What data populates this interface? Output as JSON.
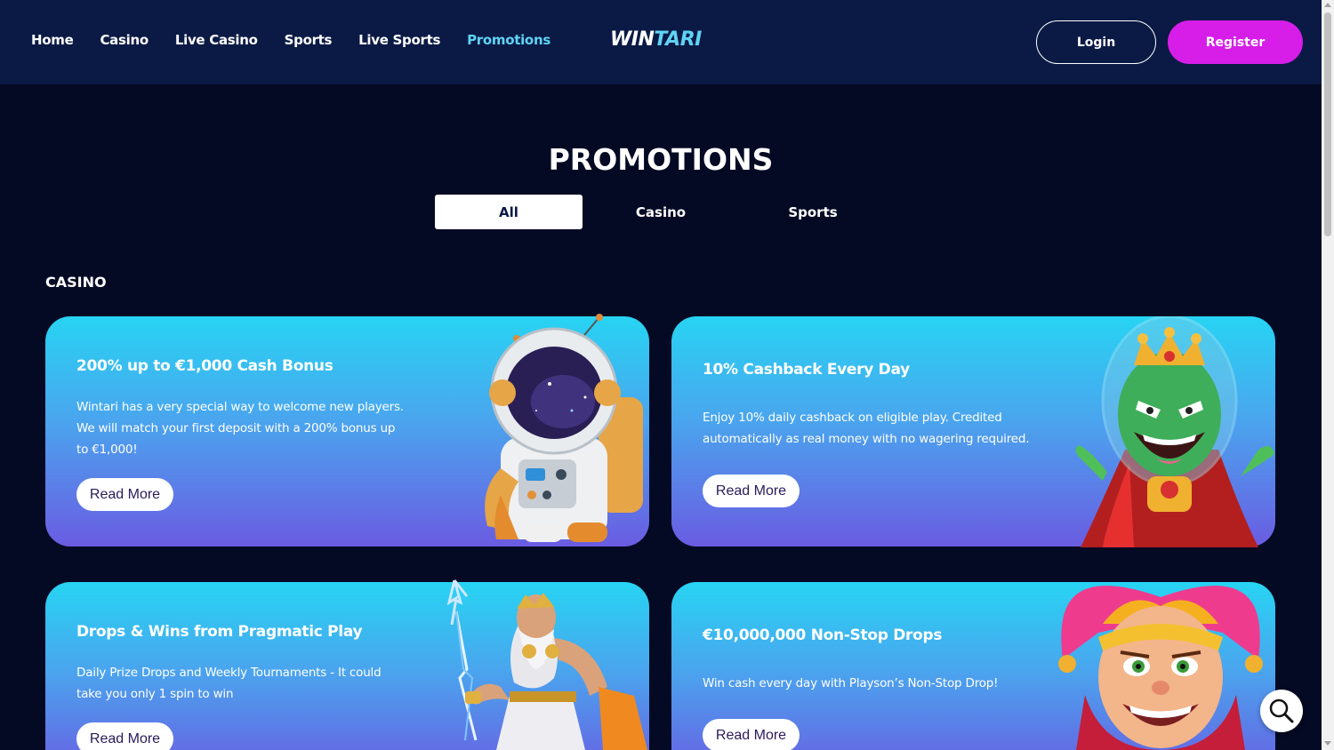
{
  "nav": {
    "items": [
      {
        "label": "Home",
        "active": false
      },
      {
        "label": "Casino",
        "active": false
      },
      {
        "label": "Live Casino",
        "active": false
      },
      {
        "label": "Sports",
        "active": false
      },
      {
        "label": "Live Sports",
        "active": false
      },
      {
        "label": "Promotions",
        "active": true
      }
    ],
    "logo_left": "WIN",
    "logo_right": "TARI",
    "login_label": "Login",
    "register_label": "Register"
  },
  "page": {
    "title": "PROMOTIONS",
    "tabs": [
      {
        "label": "All",
        "selected": true
      },
      {
        "label": "Casino",
        "selected": false
      },
      {
        "label": "Sports",
        "selected": false
      }
    ],
    "section_label": "CASINO"
  },
  "promos": [
    {
      "title": "200% up to €1,000 Cash Bonus",
      "text": "Wintari has a very special way to welcome new players. We will match your first deposit with a 200% bonus up to €1,000!",
      "button": "Read More",
      "art": "astronaut-icon"
    },
    {
      "title": "10% Cashback Every Day",
      "text": "Enjoy 10% daily cashback on eligible play. Credited automatically as real money with no wagering required.",
      "button": "Read More",
      "art": "alien-king-icon"
    },
    {
      "title": "Drops & Wins from Pragmatic Play",
      "text": "Daily Prize Drops and Weekly Tournaments - It could take you only 1 spin to win",
      "button": "Read More",
      "art": "zeus-icon"
    },
    {
      "title": "€10,000,000 Non-Stop Drops",
      "text": "Win cash every day with Playson’s Non-Stop Drop!",
      "button": "Read More",
      "art": "jester-icon"
    }
  ],
  "colors": {
    "header_bg": "#0b1a45",
    "page_bg": "#050a24",
    "accent_cyan": "#5fd3f3",
    "register_magenta": "#d61ee8",
    "card_gradient_top": "#27d4f3",
    "card_gradient_bottom": "#6a5ce2"
  },
  "icons": {
    "search_fab": "search-icon"
  }
}
